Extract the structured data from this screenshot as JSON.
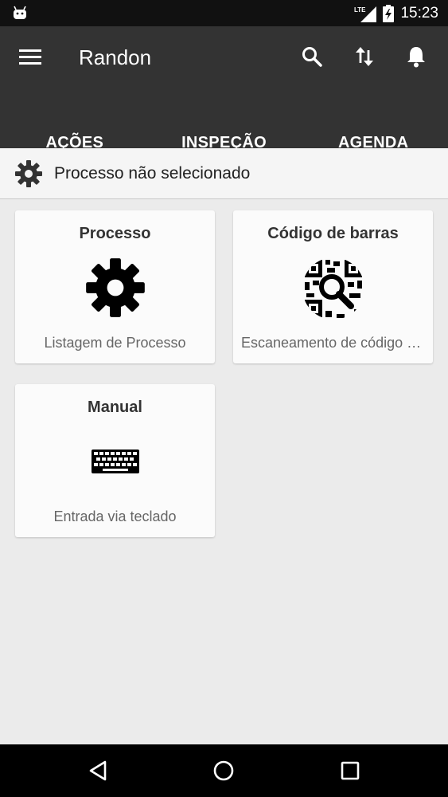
{
  "status_bar": {
    "time": "15:23",
    "network": "LTE",
    "icons": [
      "android-icon",
      "lte-signal-icon",
      "battery-charging-icon"
    ]
  },
  "app_bar": {
    "title": "Randon",
    "actions": [
      "menu-icon",
      "search-icon",
      "sync-arrows-icon",
      "bell-icon"
    ]
  },
  "tabs": [
    {
      "label": "AÇÕES",
      "active": true
    },
    {
      "label": "INSPEÇÃO",
      "active": false
    },
    {
      "label": "AGENDA",
      "active": false
    }
  ],
  "process_status": {
    "icon": "gear-icon",
    "text": "Processo não selecionado"
  },
  "cards": [
    {
      "title": "Processo",
      "subtitle": "Listagem de Processo",
      "icon": "gear-icon"
    },
    {
      "title": "Código de barras",
      "subtitle": "Escaneamento de código de barras",
      "icon": "qr-search-icon"
    },
    {
      "title": "Manual",
      "subtitle": "Entrada via teclado",
      "icon": "keyboard-icon"
    }
  ],
  "nav_bar": {
    "buttons": [
      "back-icon",
      "home-icon",
      "recents-icon"
    ]
  },
  "colors": {
    "app_bar": "#333333",
    "status_bar": "#111111",
    "background": "#ebebeb",
    "card": "#fbfbfb"
  }
}
